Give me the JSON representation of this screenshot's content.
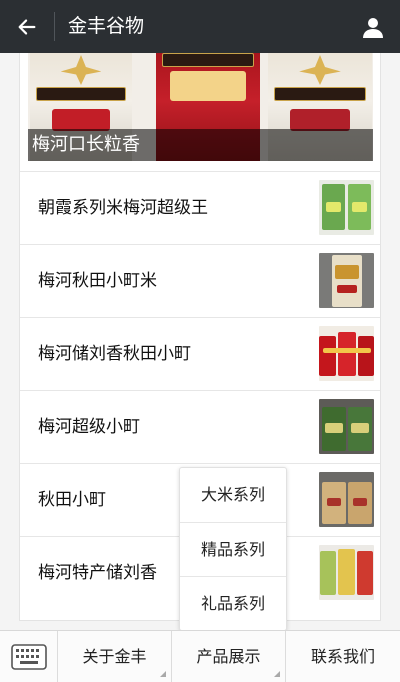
{
  "header": {
    "title": "金丰谷物",
    "back_icon": "back-arrow-icon",
    "user_icon": "user-icon",
    "background": "#2b2f33"
  },
  "banner": {
    "caption": "梅河口长粒香"
  },
  "products": [
    {
      "name": "朝霞系列米梅河超级王",
      "thumbnail": "rice-bags-green-thumbnail"
    },
    {
      "name": "梅河秋田小町米",
      "thumbnail": "rice-bag-gold-thumbnail"
    },
    {
      "name": "梅河储刘香秋田小町",
      "thumbnail": "rice-bags-red-thumbnail"
    },
    {
      "name": "梅河超级小町",
      "thumbnail": "rice-bags-dark-thumbnail"
    },
    {
      "name": "秋田小町",
      "thumbnail": "rice-bags-kraft-thumbnail"
    },
    {
      "name": "梅河特产储刘香",
      "thumbnail": "rice-bags-group-thumbnail"
    }
  ],
  "popup_menu": {
    "items": [
      "大米系列",
      "精品系列",
      "礼品系列"
    ]
  },
  "bottom_bar": {
    "keyboard_icon": "keyboard-icon",
    "tabs": [
      "关于金丰",
      "产品展示",
      "联系我们"
    ]
  }
}
